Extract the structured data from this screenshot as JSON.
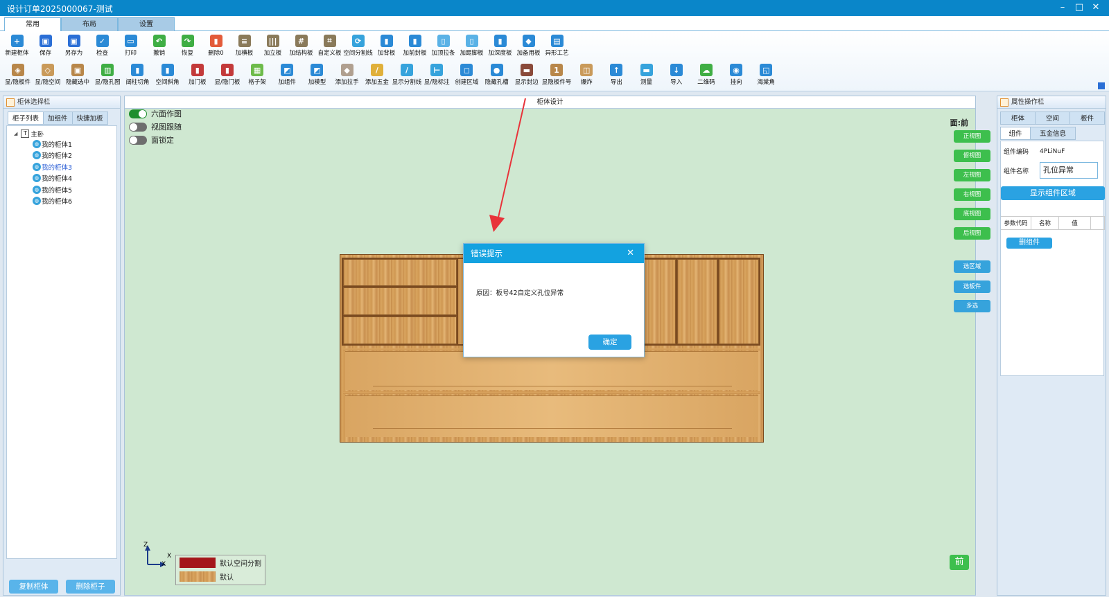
{
  "window": {
    "title": "设计订单2025000067-测试",
    "min": "–",
    "max": "□",
    "close": "✕"
  },
  "ribbon": {
    "tabs": [
      "常用",
      "布局",
      "设置"
    ],
    "row1": [
      {
        "label": "新建柜体",
        "color": "#2b8ad6",
        "glyph": "+"
      },
      {
        "label": "保存",
        "color": "#2b6fd6",
        "glyph": "▣"
      },
      {
        "label": "另存为",
        "color": "#2b6fd6",
        "glyph": "▣"
      },
      {
        "label": "检查",
        "color": "#2b8ad6",
        "glyph": "✓"
      },
      {
        "label": "打印",
        "color": "#2b8ad6",
        "glyph": "▭"
      },
      {
        "label": "撤销",
        "color": "#3fae44",
        "glyph": "↶"
      },
      {
        "label": "恢复",
        "color": "#3fae44",
        "glyph": "↷"
      },
      {
        "label": "删除0",
        "color": "#e35b3a",
        "glyph": "▮"
      },
      {
        "label": "加横板",
        "color": "#8a7a5a",
        "glyph": "≡"
      },
      {
        "label": "加立板",
        "color": "#8a7a5a",
        "glyph": "|||"
      },
      {
        "label": "加结构板",
        "color": "#8a7a5a",
        "glyph": "#"
      },
      {
        "label": "自定义板",
        "color": "#8a7a5a",
        "glyph": "⌗"
      },
      {
        "label": "空间分割线",
        "color": "#36a3dc",
        "glyph": "⟳"
      },
      {
        "label": "加背板",
        "color": "#2b8ad6",
        "glyph": "▮"
      },
      {
        "label": "加前封板",
        "color": "#2b8ad6",
        "glyph": "▮"
      },
      {
        "label": "加顶拉条",
        "color": "#5ab2e6",
        "glyph": "▯"
      },
      {
        "label": "加踢脚板",
        "color": "#5ab2e6",
        "glyph": "▯"
      },
      {
        "label": "加深度板",
        "color": "#2b8ad6",
        "glyph": "▮"
      },
      {
        "label": "加备用板",
        "color": "#2b8ad6",
        "glyph": "◆"
      },
      {
        "label": "异形工艺",
        "color": "#2b8ad6",
        "glyph": "▤"
      }
    ],
    "row2": [
      {
        "label": "显/隐板件",
        "color": "#b8874a",
        "glyph": "◈"
      },
      {
        "label": "显/隐空间",
        "color": "#c99a5a",
        "glyph": "◇"
      },
      {
        "label": "隐藏选中",
        "color": "#b8874a",
        "glyph": "▣"
      },
      {
        "label": "显/隐孔图",
        "color": "#3fae44",
        "glyph": "▥"
      },
      {
        "label": "阔柱切角",
        "color": "#2b8ad6",
        "glyph": "▮"
      },
      {
        "label": "空间斜角",
        "color": "#2b8ad6",
        "glyph": "▮"
      },
      {
        "label": "加门板",
        "color": "#c33a3a",
        "glyph": "▮"
      },
      {
        "label": "显/隐门板",
        "color": "#c33a3a",
        "glyph": "▮"
      },
      {
        "label": "格子架",
        "color": "#6dbb4a",
        "glyph": "▦"
      },
      {
        "label": "加组件",
        "color": "#2b8ad6",
        "glyph": "◩"
      },
      {
        "label": "加模型",
        "color": "#2b8ad6",
        "glyph": "◩"
      },
      {
        "label": "添加拉手",
        "color": "#b0a090",
        "glyph": "◆"
      },
      {
        "label": "添加五金",
        "color": "#e0b03a",
        "glyph": "/"
      },
      {
        "label": "显示分割线",
        "color": "#36a3dc",
        "glyph": "/"
      },
      {
        "label": "显/隐标注",
        "color": "#36a3dc",
        "glyph": "⊢"
      },
      {
        "label": "创建区域",
        "color": "#2b8ad6",
        "glyph": "◻"
      },
      {
        "label": "隐藏孔槽",
        "color": "#2b8ad6",
        "glyph": "●"
      },
      {
        "label": "显示封边",
        "color": "#8a4a3a",
        "glyph": "▬"
      },
      {
        "label": "显隐板件号",
        "color": "#b8874a",
        "glyph": "1"
      },
      {
        "label": "爆炸",
        "color": "#c99a5a",
        "glyph": "◫"
      },
      {
        "label": "导出",
        "color": "#2b8ad6",
        "glyph": "↑"
      },
      {
        "label": "测量",
        "color": "#36a3dc",
        "glyph": "▬"
      },
      {
        "label": "导入",
        "color": "#2b8ad6",
        "glyph": "↓"
      },
      {
        "label": "二维码",
        "color": "#3fae44",
        "glyph": "☁"
      },
      {
        "label": "挂向",
        "color": "#2b8ad6",
        "glyph": "◉"
      },
      {
        "label": "海棠角",
        "color": "#2b8ad6",
        "glyph": "◱"
      }
    ]
  },
  "left_panel": {
    "title": "柜体选择栏",
    "tabs": [
      "柜子列表",
      "加组件",
      "快捷加板"
    ],
    "tree_root": "主卧",
    "items": [
      "我的柜体1",
      "我的柜体2",
      "我的柜体3",
      "我的柜体4",
      "我的柜体5",
      "我的柜体6"
    ],
    "selected_index": 2,
    "copy_button": "复制柜体",
    "delete_button": "删除柜子"
  },
  "center": {
    "title": "柜体设计",
    "toggles": [
      {
        "label": "六面作图",
        "on": true
      },
      {
        "label": "视图跟随",
        "on": false
      },
      {
        "label": "面锁定",
        "on": false
      }
    ],
    "face_label": "面:前",
    "view_buttons": [
      "正视图",
      "俯视图",
      "左视图",
      "右视图",
      "底视图",
      "后视图"
    ],
    "select_buttons": [
      "选区域",
      "选板件",
      "多选"
    ],
    "axis": {
      "z": "Z",
      "x": "X"
    },
    "legend": [
      {
        "label": "默认空间分割",
        "color": "#a4161a"
      },
      {
        "label": "默认",
        "color": "#e2b27a"
      }
    ],
    "face_badge": "前"
  },
  "dialog": {
    "title": "错误提示",
    "close": "✕",
    "message": "原因：板号42自定义孔位异常",
    "ok": "确定"
  },
  "right_panel": {
    "title": "属性操作栏",
    "tabs1": [
      "柜体",
      "空间",
      "板件"
    ],
    "tabs2": [
      "组件",
      "五金信息"
    ],
    "code_label": "组件编码",
    "code_value": "4PLiNuF",
    "name_label": "组件名称",
    "name_value": "孔位异常",
    "show_button": "显示组件区域",
    "param_headers": [
      "参数代码",
      "名称",
      "值"
    ],
    "delete_button": "删组件"
  }
}
